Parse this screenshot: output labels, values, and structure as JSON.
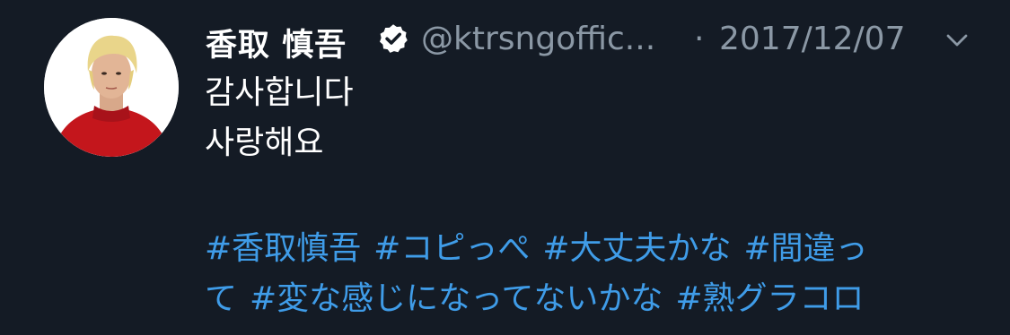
{
  "tweet": {
    "author_name": "香取 慎吾",
    "handle": "@ktrsngoffic...",
    "separator": "·",
    "date": "2017/12/07",
    "text_lines": [
      "감사합니다",
      "사랑해요"
    ],
    "hashtag_rows": [
      [
        "#香取慎吾",
        "#コピっぺ",
        "#大丈夫かな",
        "#間違っ"
      ],
      [
        "て",
        "#変な感じになってないかな",
        "#熟グラコロ"
      ]
    ],
    "colors": {
      "background": "#141b25",
      "hashtag": "#3f9ce8",
      "secondary_text": "#8b98a5"
    },
    "icons": [
      "verified-badge-icon",
      "chevron-down-icon"
    ]
  }
}
